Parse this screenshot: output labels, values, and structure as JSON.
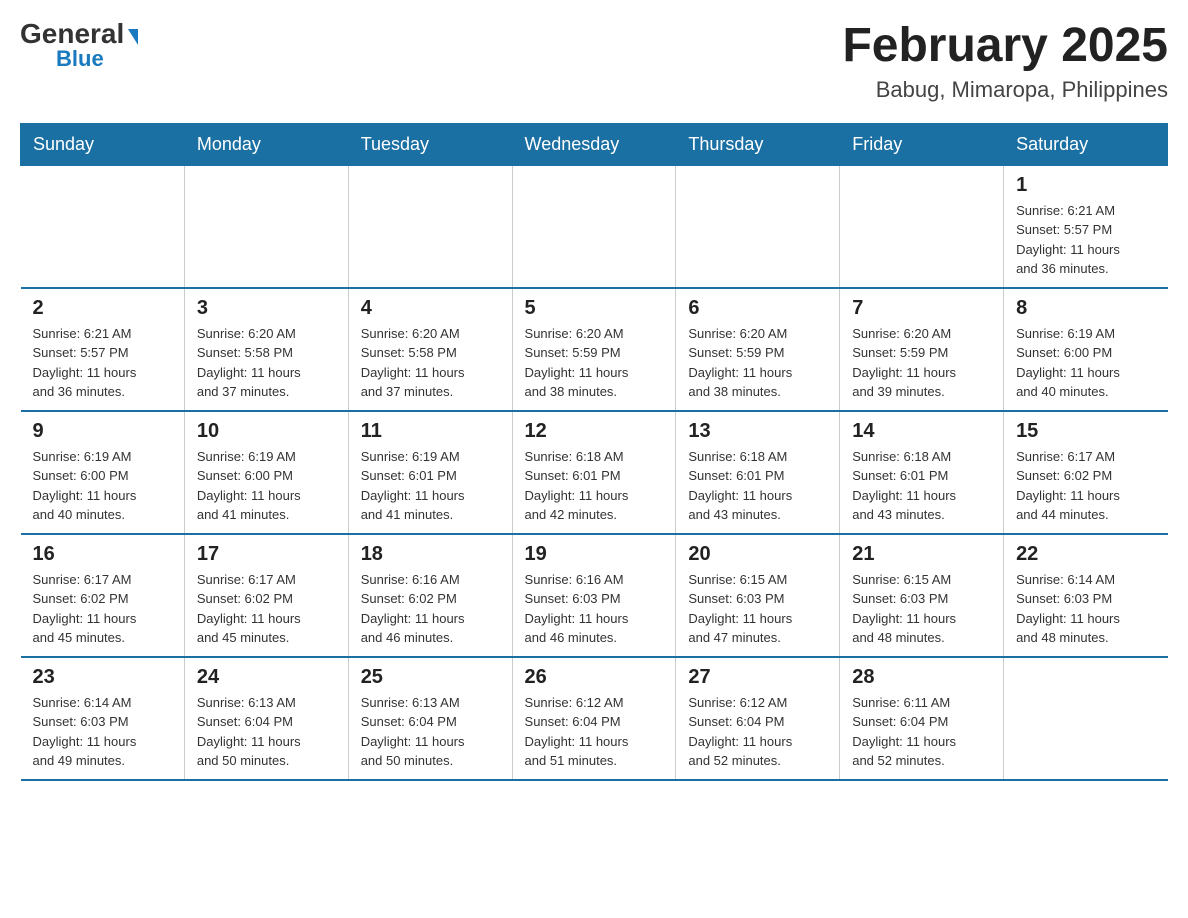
{
  "header": {
    "logo_general": "General",
    "logo_blue": "Blue",
    "title": "February 2025",
    "subtitle": "Babug, Mimaropa, Philippines"
  },
  "days_of_week": [
    "Sunday",
    "Monday",
    "Tuesday",
    "Wednesday",
    "Thursday",
    "Friday",
    "Saturday"
  ],
  "weeks": [
    [
      {
        "day": "",
        "info": ""
      },
      {
        "day": "",
        "info": ""
      },
      {
        "day": "",
        "info": ""
      },
      {
        "day": "",
        "info": ""
      },
      {
        "day": "",
        "info": ""
      },
      {
        "day": "",
        "info": ""
      },
      {
        "day": "1",
        "info": "Sunrise: 6:21 AM\nSunset: 5:57 PM\nDaylight: 11 hours\nand 36 minutes."
      }
    ],
    [
      {
        "day": "2",
        "info": "Sunrise: 6:21 AM\nSunset: 5:57 PM\nDaylight: 11 hours\nand 36 minutes."
      },
      {
        "day": "3",
        "info": "Sunrise: 6:20 AM\nSunset: 5:58 PM\nDaylight: 11 hours\nand 37 minutes."
      },
      {
        "day": "4",
        "info": "Sunrise: 6:20 AM\nSunset: 5:58 PM\nDaylight: 11 hours\nand 37 minutes."
      },
      {
        "day": "5",
        "info": "Sunrise: 6:20 AM\nSunset: 5:59 PM\nDaylight: 11 hours\nand 38 minutes."
      },
      {
        "day": "6",
        "info": "Sunrise: 6:20 AM\nSunset: 5:59 PM\nDaylight: 11 hours\nand 38 minutes."
      },
      {
        "day": "7",
        "info": "Sunrise: 6:20 AM\nSunset: 5:59 PM\nDaylight: 11 hours\nand 39 minutes."
      },
      {
        "day": "8",
        "info": "Sunrise: 6:19 AM\nSunset: 6:00 PM\nDaylight: 11 hours\nand 40 minutes."
      }
    ],
    [
      {
        "day": "9",
        "info": "Sunrise: 6:19 AM\nSunset: 6:00 PM\nDaylight: 11 hours\nand 40 minutes."
      },
      {
        "day": "10",
        "info": "Sunrise: 6:19 AM\nSunset: 6:00 PM\nDaylight: 11 hours\nand 41 minutes."
      },
      {
        "day": "11",
        "info": "Sunrise: 6:19 AM\nSunset: 6:01 PM\nDaylight: 11 hours\nand 41 minutes."
      },
      {
        "day": "12",
        "info": "Sunrise: 6:18 AM\nSunset: 6:01 PM\nDaylight: 11 hours\nand 42 minutes."
      },
      {
        "day": "13",
        "info": "Sunrise: 6:18 AM\nSunset: 6:01 PM\nDaylight: 11 hours\nand 43 minutes."
      },
      {
        "day": "14",
        "info": "Sunrise: 6:18 AM\nSunset: 6:01 PM\nDaylight: 11 hours\nand 43 minutes."
      },
      {
        "day": "15",
        "info": "Sunrise: 6:17 AM\nSunset: 6:02 PM\nDaylight: 11 hours\nand 44 minutes."
      }
    ],
    [
      {
        "day": "16",
        "info": "Sunrise: 6:17 AM\nSunset: 6:02 PM\nDaylight: 11 hours\nand 45 minutes."
      },
      {
        "day": "17",
        "info": "Sunrise: 6:17 AM\nSunset: 6:02 PM\nDaylight: 11 hours\nand 45 minutes."
      },
      {
        "day": "18",
        "info": "Sunrise: 6:16 AM\nSunset: 6:02 PM\nDaylight: 11 hours\nand 46 minutes."
      },
      {
        "day": "19",
        "info": "Sunrise: 6:16 AM\nSunset: 6:03 PM\nDaylight: 11 hours\nand 46 minutes."
      },
      {
        "day": "20",
        "info": "Sunrise: 6:15 AM\nSunset: 6:03 PM\nDaylight: 11 hours\nand 47 minutes."
      },
      {
        "day": "21",
        "info": "Sunrise: 6:15 AM\nSunset: 6:03 PM\nDaylight: 11 hours\nand 48 minutes."
      },
      {
        "day": "22",
        "info": "Sunrise: 6:14 AM\nSunset: 6:03 PM\nDaylight: 11 hours\nand 48 minutes."
      }
    ],
    [
      {
        "day": "23",
        "info": "Sunrise: 6:14 AM\nSunset: 6:03 PM\nDaylight: 11 hours\nand 49 minutes."
      },
      {
        "day": "24",
        "info": "Sunrise: 6:13 AM\nSunset: 6:04 PM\nDaylight: 11 hours\nand 50 minutes."
      },
      {
        "day": "25",
        "info": "Sunrise: 6:13 AM\nSunset: 6:04 PM\nDaylight: 11 hours\nand 50 minutes."
      },
      {
        "day": "26",
        "info": "Sunrise: 6:12 AM\nSunset: 6:04 PM\nDaylight: 11 hours\nand 51 minutes."
      },
      {
        "day": "27",
        "info": "Sunrise: 6:12 AM\nSunset: 6:04 PM\nDaylight: 11 hours\nand 52 minutes."
      },
      {
        "day": "28",
        "info": "Sunrise: 6:11 AM\nSunset: 6:04 PM\nDaylight: 11 hours\nand 52 minutes."
      },
      {
        "day": "",
        "info": ""
      }
    ]
  ],
  "colors": {
    "header_bg": "#1a6fa3",
    "header_text": "#ffffff",
    "border": "#1a6fa3",
    "logo_blue": "#1a7abf"
  }
}
